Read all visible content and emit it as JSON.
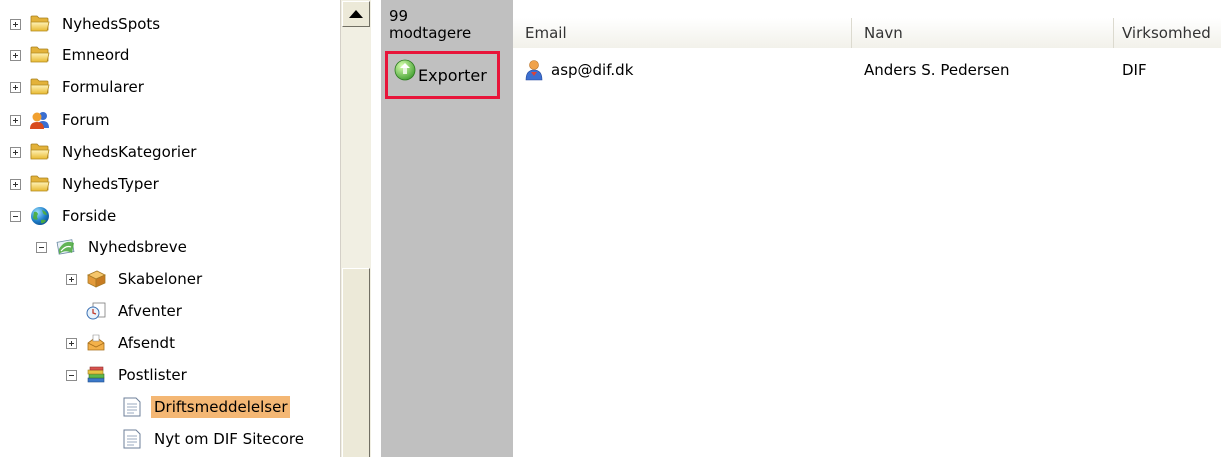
{
  "tree": {
    "nodes": [
      {
        "label": "NyhedsSpots",
        "icon": "folder-icon",
        "expander": "plus"
      },
      {
        "label": "Emneord",
        "icon": "folder-icon",
        "expander": "plus"
      },
      {
        "label": "Formularer",
        "icon": "folder-icon",
        "expander": "plus"
      },
      {
        "label": "Forum",
        "icon": "forum-people-icon",
        "expander": "plus"
      },
      {
        "label": "NyhedsKategorier",
        "icon": "folder-icon",
        "expander": "plus"
      },
      {
        "label": "NyhedsTyper",
        "icon": "folder-icon",
        "expander": "plus"
      },
      {
        "label": "Forside",
        "icon": "globe-icon",
        "expander": "minus"
      },
      {
        "label": "Nyhedsbreve",
        "icon": "newsletter-icon",
        "expander": "minus"
      },
      {
        "label": "Skabeloner",
        "icon": "template-icon",
        "expander": "plus"
      },
      {
        "label": "Afventer",
        "icon": "pending-icon",
        "expander": "none"
      },
      {
        "label": "Afsendt",
        "icon": "sent-icon",
        "expander": "plus"
      },
      {
        "label": "Postlister",
        "icon": "books-icon",
        "expander": "minus"
      },
      {
        "label": "Driftsmeddelelser",
        "icon": "document-icon",
        "expander": "none",
        "selected": true
      },
      {
        "label": "Nyt om DIF Sitecore",
        "icon": "document-icon",
        "expander": "none"
      }
    ]
  },
  "strip": {
    "recipients_count": "99",
    "recipients_word": "modtagere",
    "export_label": "Exporter"
  },
  "grid": {
    "columns": [
      "Email",
      "Navn",
      "Virksomhed"
    ],
    "rows": [
      {
        "email": "asp@dif.dk",
        "navn": "Anders S. Pedersen",
        "virksomhed": "DIF"
      }
    ]
  },
  "colors": {
    "selection": "#f4b774",
    "strip_gray": "#c0c0c0",
    "highlight_border": "#e8153a"
  }
}
